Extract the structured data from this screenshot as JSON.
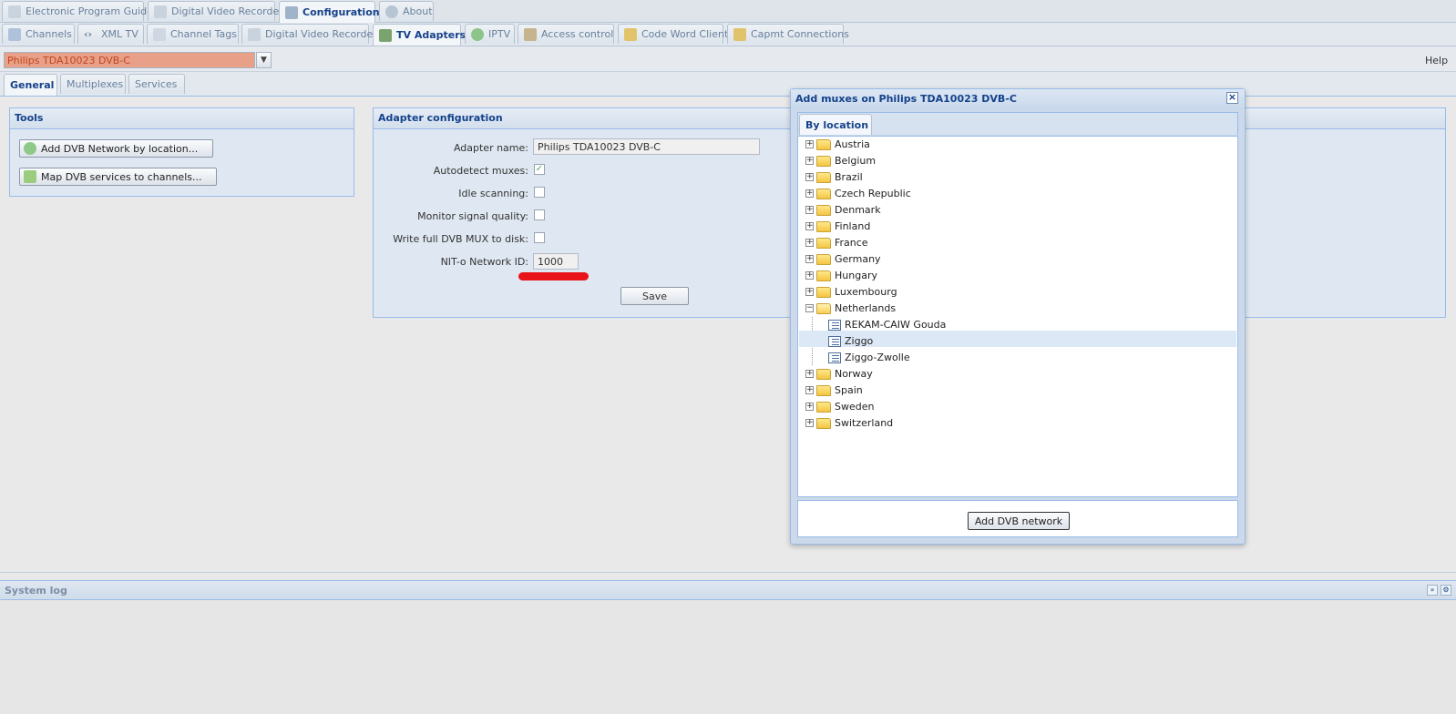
{
  "top_tabs": [
    "Electronic Program Guide",
    "Digital Video Recorder",
    "Configuration",
    "About"
  ],
  "config_tabs": [
    "Channels",
    "XML TV",
    "Channel Tags",
    "Digital Video Recorder",
    "TV Adapters",
    "IPTV",
    "Access control",
    "Code Word Client",
    "Capmt Connections"
  ],
  "adapter_select": "Philips TDA10023 DVB-C",
  "help": "Help",
  "sub_tabs": [
    "General",
    "Multiplexes",
    "Services"
  ],
  "tools": {
    "title": "Tools",
    "add_network": "Add DVB Network by location...",
    "map_services": "Map DVB services to channels..."
  },
  "adapter_config": {
    "title": "Adapter configuration",
    "name_label": "Adapter name:",
    "name_value": "Philips TDA10023 DVB-C",
    "autodetect_label": "Autodetect muxes:",
    "autodetect_checked": true,
    "idle_label": "Idle scanning:",
    "idle_checked": false,
    "monitor_label": "Monitor signal quality:",
    "monitor_checked": false,
    "write_label": "Write full DVB MUX to disk:",
    "write_checked": false,
    "nit_label": "NIT-o Network ID:",
    "nit_value": "1000",
    "save": "Save"
  },
  "dialog": {
    "title": "Add muxes on Philips TDA10023 DVB-C",
    "tab": "By location",
    "tree": [
      {
        "label": "Austria",
        "type": "folder"
      },
      {
        "label": "Belgium",
        "type": "folder"
      },
      {
        "label": "Brazil",
        "type": "folder"
      },
      {
        "label": "Czech Republic",
        "type": "folder"
      },
      {
        "label": "Denmark",
        "type": "folder"
      },
      {
        "label": "Finland",
        "type": "folder"
      },
      {
        "label": "France",
        "type": "folder"
      },
      {
        "label": "Germany",
        "type": "folder"
      },
      {
        "label": "Hungary",
        "type": "folder"
      },
      {
        "label": "Luxembourg",
        "type": "folder"
      },
      {
        "label": "Netherlands",
        "type": "folder-open"
      },
      {
        "label": "REKAM-CAIW Gouda",
        "type": "leaf"
      },
      {
        "label": "Ziggo",
        "type": "leaf",
        "selected": true
      },
      {
        "label": "Ziggo-Zwolle",
        "type": "leaf"
      },
      {
        "label": "Norway",
        "type": "folder"
      },
      {
        "label": "Spain",
        "type": "folder"
      },
      {
        "label": "Sweden",
        "type": "folder"
      },
      {
        "label": "Switzerland",
        "type": "folder"
      }
    ],
    "add_button": "Add DVB network"
  },
  "system_log": "System log",
  "colors": {
    "accent": "#15428b",
    "selection": "#dde8f7",
    "annotation": "#e8131b",
    "adapter_highlight": "#e8a088"
  }
}
